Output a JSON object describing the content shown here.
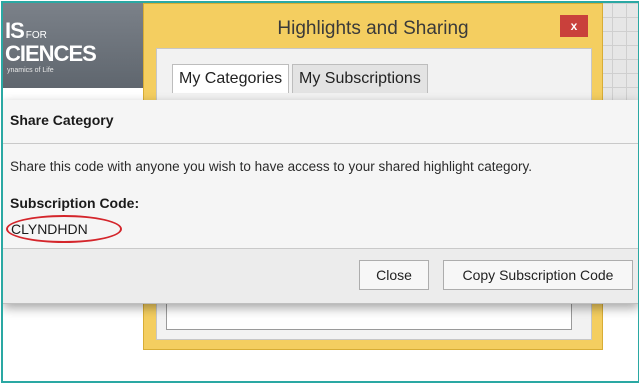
{
  "background_app": {
    "logo_line1": "IS",
    "logo_line1_small": "FOR",
    "logo_line2": "CIENCES",
    "logo_line3": "ynamics of Life"
  },
  "highlights_window": {
    "title": "Highlights and Sharing",
    "close_label": "x",
    "tabs": [
      {
        "label": "My Categories",
        "active": true
      },
      {
        "label": "My Subscriptions",
        "active": false
      }
    ],
    "accent_color": "#f4ce60"
  },
  "dialog": {
    "title": "Share Category",
    "description": "Share this code with anyone you wish to have access to your shared highlight category.",
    "code_label": "Subscription Code:",
    "code_value": "CLYNDHDN",
    "buttons": {
      "close": "Close",
      "copy": "Copy Subscription Code"
    },
    "annotation_color": "#d4252b"
  }
}
